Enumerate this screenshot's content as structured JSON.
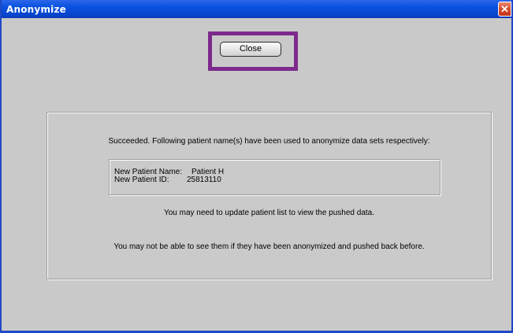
{
  "window": {
    "title": "Anonymize",
    "close_glyph": "✕"
  },
  "toolbar": {
    "close_label": "Close",
    "highlight_color": "#7d2a8c"
  },
  "panel": {
    "succeeded_message": "Succeeded. Following patient name(s) have been used to anonymize data sets respectively:",
    "info": {
      "name_label": "New Patient Name:",
      "name_value": "Patient H",
      "id_label": "New Patient ID:",
      "id_value": "25813110"
    },
    "update_note": "You may need to update patient list to view the pushed data.",
    "warning_note": "You may not be able to see them if they have been anonymized and pushed back before."
  },
  "colors": {
    "titlebar": "#0a52e0",
    "window_bg": "#c9c9c9"
  }
}
